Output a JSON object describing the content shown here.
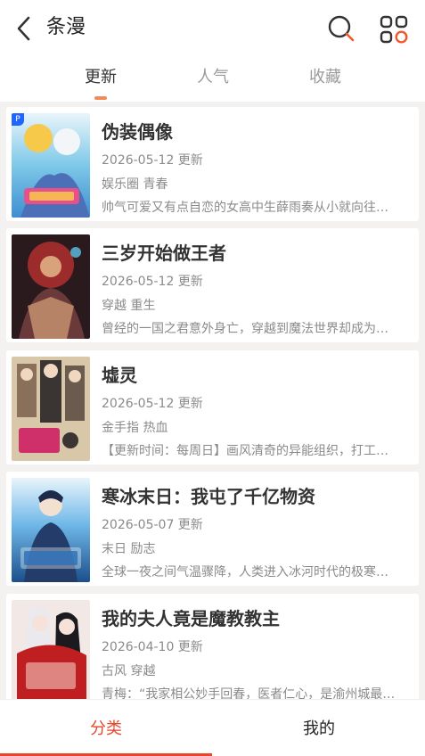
{
  "header": {
    "title": "条漫"
  },
  "tabs": [
    {
      "label": "更新",
      "active": true
    },
    {
      "label": "人气",
      "active": false
    },
    {
      "label": "收藏",
      "active": false
    }
  ],
  "comics": [
    {
      "title": "伪装偶像",
      "date": "2026-05-12 更新",
      "tags": "娱乐圈 青春",
      "desc": "帅气可爱又有点自恋的女高中生薛雨奏从小就向往…",
      "cover_colors": [
        "#7ec8e8",
        "#f6c94a",
        "#e8508c"
      ]
    },
    {
      "title": "三岁开始做王者",
      "date": "2026-05-12 更新",
      "tags": "穿越 重生",
      "desc": "曾经的一国之君意外身亡，穿越到魔法世界却成为…",
      "cover_colors": [
        "#2a1a1e",
        "#9c2c2c",
        "#d9a27a"
      ]
    },
    {
      "title": "墟灵",
      "date": "2026-05-12 更新",
      "tags": "金手指 热血",
      "desc": "【更新时间：每周日】画风清奇的异能组织，打工…",
      "cover_colors": [
        "#d8c7a8",
        "#3a3433",
        "#d0306a"
      ]
    },
    {
      "title": "寒冰末日：我屯了千亿物资",
      "date": "2026-05-07 更新",
      "tags": "末日 励志",
      "desc": "全球一夜之间气温骤降，人类进入冰河时代的极寒…",
      "cover_colors": [
        "#1b4f8c",
        "#6fb8e8",
        "#e8f4fb"
      ]
    },
    {
      "title": "我的夫人竟是魔教教主",
      "date": "2026-04-10 更新",
      "tags": "古风 穿越",
      "desc": "青梅：“我家相公妙手回春，医者仁心，是渝州城最…",
      "cover_colors": [
        "#f2e8e6",
        "#c01f22",
        "#f6d9d2"
      ]
    }
  ],
  "bottom_nav": [
    {
      "label": "分类",
      "active": true
    },
    {
      "label": "我的",
      "active": false
    }
  ],
  "colors": {
    "accent": "#e8452c",
    "tab_indicator": "#f08b5e"
  }
}
